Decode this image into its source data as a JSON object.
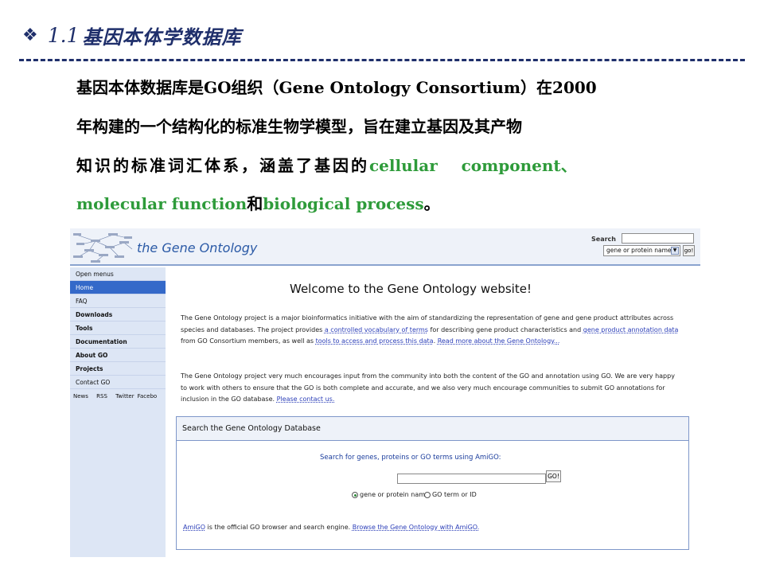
{
  "slide": {
    "title_bullet": "❖",
    "title_number": "1.1",
    "title_text": "基因本体学数据库",
    "paragraph": {
      "l1": "基因本体数据库是GO组织（Gene  Ontology  Consortium）在2000",
      "l2": "年构建的一个结构化的标准生物学模型，旨在建立基因及其产物",
      "l3_text": "知识的标准词汇体系，涵盖了基因的",
      "l3_green1": "cellular",
      "l3_green2": "component",
      "l3_sep": "、",
      "l4_green1": "molecular function",
      "l4_and": "和",
      "l4_green2": "biological process",
      "l4_end": "。"
    }
  },
  "site": {
    "brand": "the Gene Ontology",
    "search_label": "Search",
    "search_select": "gene or protein name",
    "search_go": "go!",
    "sidebar": [
      {
        "label": "Open menus"
      },
      {
        "label": "Home"
      },
      {
        "label": "FAQ"
      },
      {
        "label": "Downloads"
      },
      {
        "label": "Tools"
      },
      {
        "label": "Documentation"
      },
      {
        "label": "About GO"
      },
      {
        "label": "Projects"
      },
      {
        "label": "Contact GO"
      }
    ],
    "footer_links": [
      "News",
      "RSS",
      "Twitter",
      "Facebo"
    ],
    "welcome": "Welcome to the Gene Ontology website!",
    "intro1": {
      "a": "The Gene Ontology project is a major bioinformatics initiative with the aim of standardizing the representation of gene and gene product attributes across species and databases. The project provides ",
      "link1": "a controlled vocabulary of terms",
      "b": " for describing gene product characteristics and ",
      "link2": "gene product annotation data",
      "c": " from GO Consortium members, as well as ",
      "link3": "tools to access and process this data",
      "d": ". ",
      "link4": "Read more about the Gene Ontology..."
    },
    "intro2": {
      "a": "The Gene Ontology project very much encourages input from the community into both the content of the GO and annotation using GO. We are very happy to work with others to ensure that the GO is both complete and accurate, and we also very much encourage communities to submit GO annotations for inclusion in the GO database. ",
      "link": "Please contact us."
    },
    "search_panel": {
      "title": "Search the Gene Ontology Database",
      "amigo_label": "Search for genes, proteins or GO terms using AmiGO:",
      "go_button": "GO!",
      "radio1": "gene or protein name",
      "radio2": "GO term or ID",
      "note_link1": "AmiGO",
      "note_text": " is the official GO browser and search engine. ",
      "note_link2": "Browse the Gene Ontology with AmiGO."
    }
  }
}
